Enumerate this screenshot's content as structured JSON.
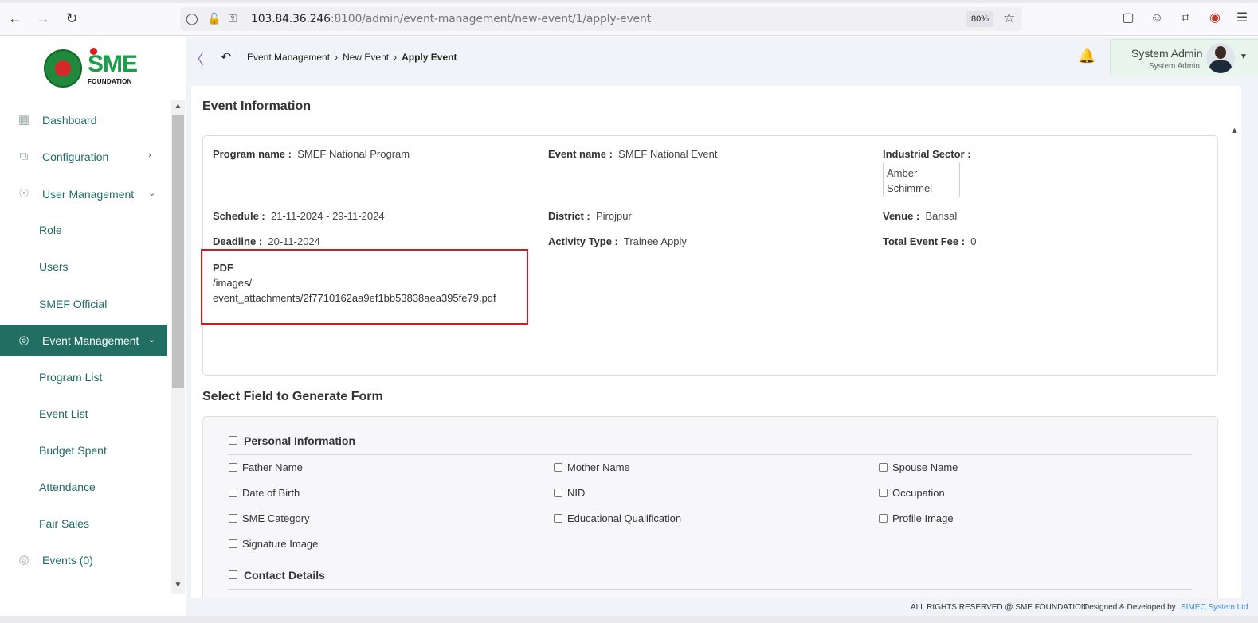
{
  "browser": {
    "url_host": "103.84.36.246",
    "url_rest": ":8100/admin/event-management/new-event/1/apply-event",
    "zoom": "80%"
  },
  "logo": {
    "sme": "SME",
    "foundation": "FOUNDATION"
  },
  "sidebar": {
    "items": [
      {
        "label": "Dashboard"
      },
      {
        "label": "Configuration"
      },
      {
        "label": "User Management"
      },
      {
        "label": "Role"
      },
      {
        "label": "Users"
      },
      {
        "label": "SMEF Official"
      },
      {
        "label": "Event Management"
      },
      {
        "label": "Program List"
      },
      {
        "label": "Event List"
      },
      {
        "label": "Budget Spent"
      },
      {
        "label": "Attendance"
      },
      {
        "label": "Fair Sales"
      },
      {
        "label": "Events (0)"
      }
    ]
  },
  "header": {
    "breadcrumb": [
      "Event Management",
      "New Event",
      "Apply Event"
    ],
    "user_name": "System Admin",
    "user_role": "System Admin"
  },
  "event_info": {
    "title": "Event Information",
    "program_label": "Program name :",
    "program_value": "SMEF National Program",
    "event_label": "Event name :",
    "event_value": "SMEF National Event",
    "sector_label": "Industrial Sector :",
    "sector_values": [
      "Amber",
      "Schimmel"
    ],
    "schedule_label": "Schedule :",
    "schedule_value": "21-11-2024 - 29-11-2024",
    "district_label": "District :",
    "district_value": "Pirojpur",
    "venue_label": "Venue :",
    "venue_value": "Barisal",
    "deadline_label": "Deadline :",
    "deadline_value": "20-11-2024",
    "activity_label": "Activity Type :",
    "activity_value": "Trainee Apply",
    "fee_label": "Total Event Fee :",
    "fee_value": "0",
    "pdf_label": "PDF",
    "pdf_path_1": "/images/",
    "pdf_path_2": "event_attachments/2f7710162aa9ef1bb53838aea395fe79.pdf"
  },
  "form": {
    "title": "Select Field to Generate Form",
    "personal_title": "Personal Information",
    "fields": [
      "Father Name",
      "Mother Name",
      "Spouse Name",
      "Date of Birth",
      "NID",
      "Occupation",
      "SME Category",
      "Educational Qualification",
      "Profile Image",
      "Signature Image"
    ],
    "contact_title": "Contact Details"
  },
  "footer": {
    "rights": "ALL RIGHTS RESERVED @ SME FOUNDATION",
    "designed": "Designed & Developed by",
    "company": "SIMEC System Ltd"
  },
  "colors": {
    "sidebar_active": "#226e62",
    "sidebar_text": "#1f6b64",
    "highlight": "#e0141e",
    "footer_link": "#3a8fd6"
  }
}
